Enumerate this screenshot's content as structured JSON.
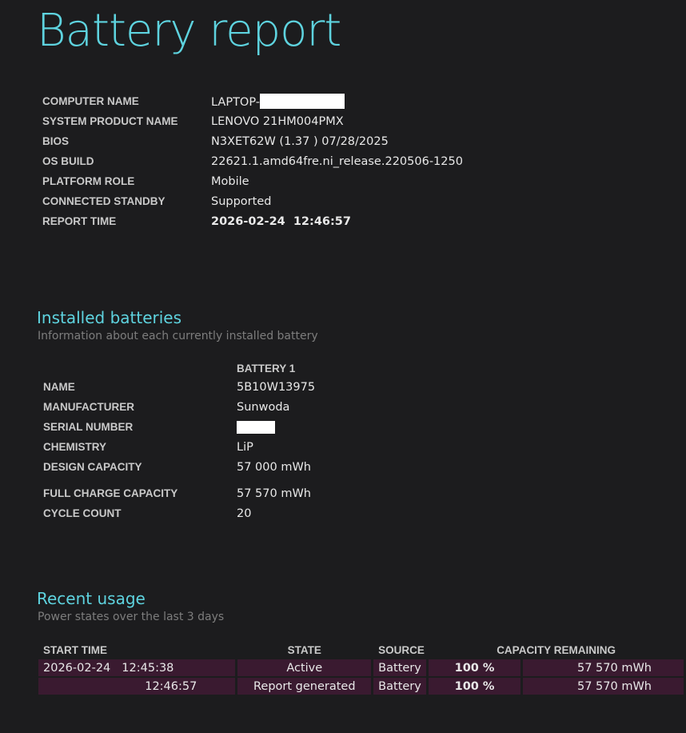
{
  "title": "Battery report",
  "system_info": [
    {
      "label": "COMPUTER NAME",
      "value": "LAPTOP-",
      "redacted": true
    },
    {
      "label": "SYSTEM PRODUCT NAME",
      "value": "LENOVO 21HM004PMX"
    },
    {
      "label": "BIOS",
      "value": "N3XET62W (1.37 ) 07/28/2025"
    },
    {
      "label": "OS BUILD",
      "value": "22621.1.amd64fre.ni_release.220506-1250"
    },
    {
      "label": "PLATFORM ROLE",
      "value": "Mobile"
    },
    {
      "label": "CONNECTED STANDBY",
      "value": "Supported"
    },
    {
      "label": "REPORT TIME",
      "value": "2026-02-24  12:46:57"
    }
  ],
  "installed_batteries": {
    "title": "Installed batteries",
    "subtitle": "Information about each currently installed battery",
    "column_header": "BATTERY 1",
    "rows": [
      {
        "label": "NAME",
        "value": "5B10W13975"
      },
      {
        "label": "MANUFACTURER",
        "value": "Sunwoda"
      },
      {
        "label": "SERIAL NUMBER",
        "value": "",
        "redacted": true
      },
      {
        "label": "CHEMISTRY",
        "value": "LiP"
      },
      {
        "label": "DESIGN CAPACITY",
        "value": "57 000 mWh"
      },
      {
        "label": "FULL CHARGE CAPACITY",
        "value": "57 570 mWh"
      },
      {
        "label": "CYCLE COUNT",
        "value": "20"
      }
    ]
  },
  "recent_usage": {
    "title": "Recent usage",
    "subtitle": "Power states over the last 3 days",
    "headers": [
      "START TIME",
      "STATE",
      "SOURCE",
      "CAPACITY REMAINING"
    ],
    "rows": [
      {
        "start_date": "2026-02-24",
        "start_time": "12:45:38",
        "state": "Active",
        "source": "Battery",
        "percent": "100 %",
        "mwh": "57 570 mWh"
      },
      {
        "start_date": "",
        "start_time": "12:46:57",
        "state": "Report generated",
        "source": "Battery",
        "percent": "100 %",
        "mwh": "57 570 mWh"
      }
    ]
  },
  "colors": {
    "background": "#1c1c1e",
    "accent": "#5ed3df",
    "row_fill": "#3a1a30"
  }
}
